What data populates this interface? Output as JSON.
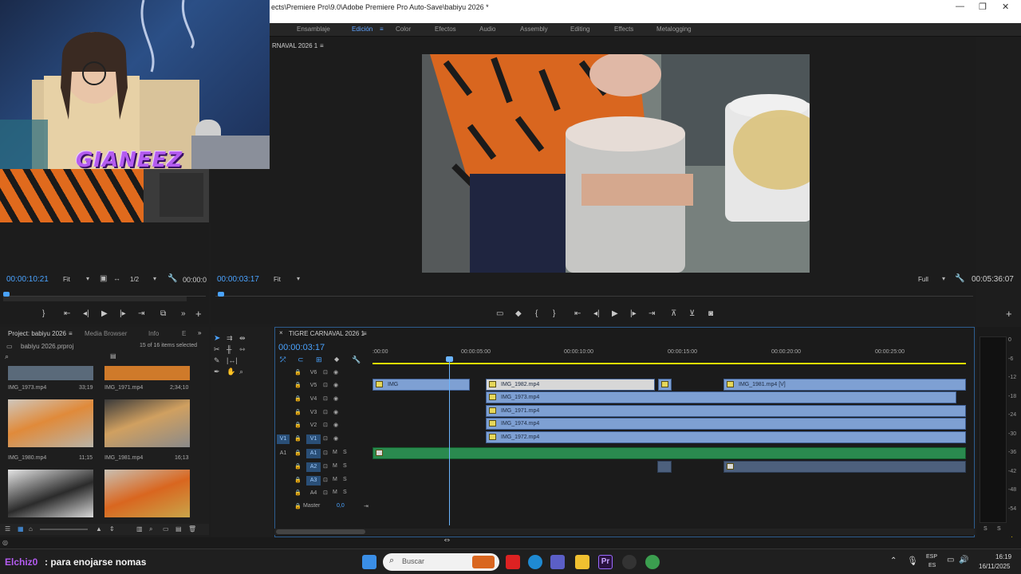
{
  "titlebar": {
    "path": "ects\\Premiere Pro\\9.0\\Adobe Premiere Pro Auto-Save\\babiyu 2026 *",
    "minimize": "—",
    "maximize": "❐",
    "close": "✕"
  },
  "workspaces": [
    "Ensamblaje",
    "Edición",
    "Color",
    "Efectos",
    "Audio",
    "Assembly",
    "Editing",
    "Effects",
    "Metalogging"
  ],
  "workspaces_menu_icon": "≡",
  "source_monitor": {
    "tab": "RNAVAL 2026 1",
    "menu": "≡",
    "timecode": "00:00:10:21",
    "fit": "Fit",
    "fraction": "1/2",
    "out_timecode": "00:00:0"
  },
  "program_monitor": {
    "timecode": "00:00:03:17",
    "fit": "Fit",
    "quality": "Full",
    "duration": "00:05:36:07"
  },
  "project_panel": {
    "tabs": [
      "Project: babiyu 2026",
      "Media Browser",
      "Info",
      "E"
    ],
    "menu": "≡",
    "more": "»",
    "file": "babiyu 2026.prproj",
    "selection": "15 of 16 items selected",
    "items": [
      {
        "name": "IMG_1973.mp4",
        "duration": "33;19"
      },
      {
        "name": "IMG_1971.mp4",
        "duration": "2;34;10"
      },
      {
        "name": "IMG_1980.mp4",
        "duration": "11;15"
      },
      {
        "name": "IMG_1981.mp4",
        "duration": "16;13"
      },
      {
        "name": "",
        "duration": ""
      },
      {
        "name": "",
        "duration": ""
      }
    ]
  },
  "timeline": {
    "tab": "TIGRE CARNAVAL 2026 1",
    "close": "×",
    "menu": "≡",
    "timecode": "00:00:03:17",
    "ruler": [
      ":00:00",
      "00:00:05:00",
      "00:00:10:00",
      "00:00:15:00",
      "00:00:20:00",
      "00:00:25:00"
    ],
    "video_tracks": [
      "V6",
      "V5",
      "V4",
      "V3",
      "V2",
      "V1"
    ],
    "source_video": "V1",
    "audio_tracks": [
      "A1",
      "A2",
      "A3",
      "A4"
    ],
    "source_audio": "A1",
    "master_label": "Master",
    "master_value": "0,0",
    "m": "M",
    "s": "S",
    "clips": {
      "v5_a": "IMG",
      "v5_b": "IMG_1982.mp4",
      "v5_c": "IMG_1981.mp4 [V]",
      "v4": "IMG_1973.mp4",
      "v3": "IMG_1971.mp4",
      "v2": "IMG_1974.mp4",
      "v1": "IMG_1972.mp4"
    }
  },
  "meter": {
    "scale": [
      "0",
      "-6",
      "-12",
      "-18",
      "-24",
      "-30",
      "-36",
      "-42",
      "-48",
      "-54"
    ],
    "s_left": "S",
    "s_right": "S"
  },
  "overlay": {
    "streamer": "GIANEEZ",
    "chat_user": "Elchiz0",
    "chat_message": ": para enojarse nomas"
  },
  "taskbar": {
    "search_placeholder": "Buscar",
    "lang_top": "ESP",
    "lang_bottom": "ES",
    "time": "16:19",
    "date": "16/11/2025",
    "premiere": "Pr"
  },
  "colors": {
    "accent": "#4aa3ff",
    "clip_video": "#7ea0d3",
    "clip_audio": "#2a8a4f",
    "playhead": "#6bb5ff",
    "work_area": "#e2e200"
  }
}
